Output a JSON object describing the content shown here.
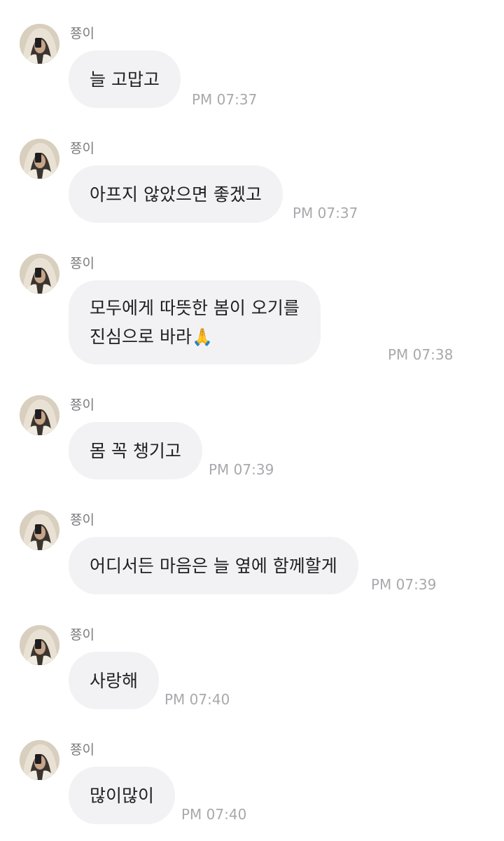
{
  "messages": [
    {
      "sender": "쭁이",
      "lines": [
        "늘 고맙고"
      ],
      "time": "PM 07:37"
    },
    {
      "sender": "쭁이",
      "lines": [
        "아프지 않았으면 좋겠고"
      ],
      "time": "PM 07:37"
    },
    {
      "sender": "쭁이",
      "lines": [
        "모두에게 따뜻한 봄이 오기를",
        "진심으로 바라"
      ],
      "emoji": "🙏",
      "time": "PM 07:38"
    },
    {
      "sender": "쭁이",
      "lines": [
        "몸 꼭 챙기고"
      ],
      "time": "PM 07:39"
    },
    {
      "sender": "쭁이",
      "lines": [
        "어디서든 마음은 늘 옆에 함께할게"
      ],
      "time": "PM 07:39"
    },
    {
      "sender": "쭁이",
      "lines": [
        "사랑해"
      ],
      "time": "PM 07:40"
    },
    {
      "sender": "쭁이",
      "lines": [
        "많이많이"
      ],
      "time": "PM 07:40"
    }
  ],
  "colors": {
    "bubble": "#f2f2f5",
    "sender": "#7c7c80",
    "timestamp": "#a9a9ad",
    "message_text": "#202024"
  },
  "icons": {
    "avatar": "profile-photo-avatar",
    "emoji": "folded-hands"
  }
}
